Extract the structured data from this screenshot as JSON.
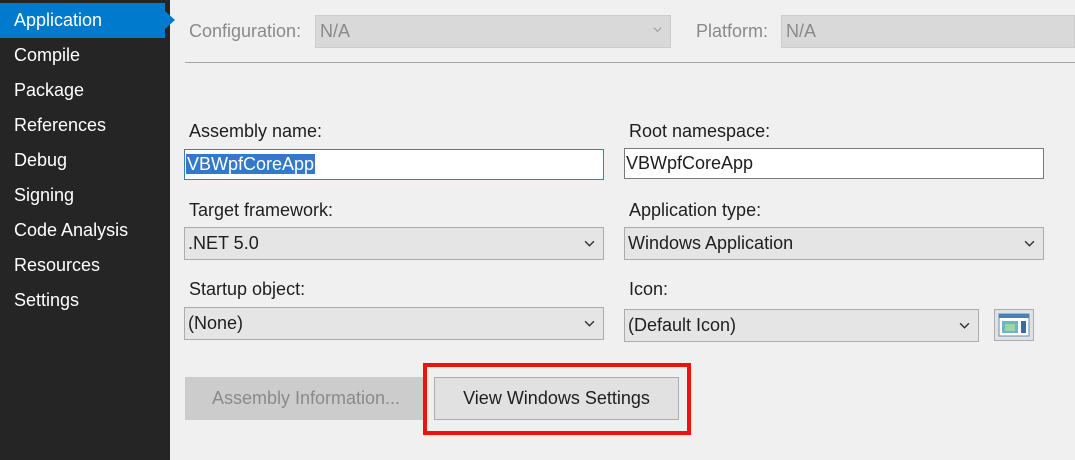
{
  "sidebar": {
    "items": [
      {
        "label": "Application"
      },
      {
        "label": "Compile"
      },
      {
        "label": "Package"
      },
      {
        "label": "References"
      },
      {
        "label": "Debug"
      },
      {
        "label": "Signing"
      },
      {
        "label": "Code Analysis"
      },
      {
        "label": "Resources"
      },
      {
        "label": "Settings"
      }
    ],
    "active_label": "Application"
  },
  "config_bar": {
    "configuration_label": "Configuration:",
    "configuration_value": "N/A",
    "platform_label": "Platform:",
    "platform_value": "N/A"
  },
  "form": {
    "assembly_name_label": "Assembly name:",
    "assembly_name_value": "VBWpfCoreApp",
    "root_namespace_label": "Root namespace:",
    "root_namespace_value": "VBWpfCoreApp",
    "target_framework_label": "Target framework:",
    "target_framework_value": ".NET 5.0",
    "application_type_label": "Application type:",
    "application_type_value": "Windows Application",
    "startup_object_label": "Startup object:",
    "startup_object_value": "(None)",
    "icon_label": "Icon:",
    "icon_value": "(Default Icon)"
  },
  "buttons": {
    "assembly_information": "Assembly Information...",
    "view_windows_settings": "View Windows Settings"
  },
  "colors": {
    "sidebar_bg": "#252526",
    "active_bg": "#007acc",
    "highlight": "#ee1111",
    "selection": "#3378c9"
  }
}
